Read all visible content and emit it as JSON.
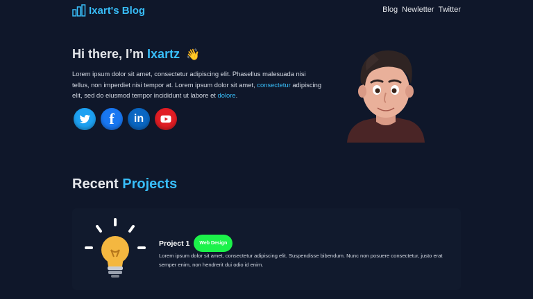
{
  "brand": {
    "name": "Ixart's Blog",
    "icon": "bar-chart-icon"
  },
  "nav": {
    "links": [
      "Blog",
      "Newletter",
      "Twitter"
    ]
  },
  "hero": {
    "greeting": "Hi there, I’m",
    "name": "Ixartz",
    "wave": "👋",
    "desc_part1": "Lorem ipsum dolor sit amet, consectetur adipiscing elit. Phasellus malesuada nisi tellus, non imperdiet nisi tempor at. Lorem ipsum dolor sit amet,",
    "link1": "consectetur",
    "desc_part2": "adipiscing elit, sed do eiusmod tempor incididunt ut labore et",
    "link2": "dolore",
    "desc_end": ".",
    "socials": [
      {
        "name": "twitter",
        "glyph": ""
      },
      {
        "name": "facebook",
        "glyph": "f"
      },
      {
        "name": "linkedin",
        "glyph": "in"
      },
      {
        "name": "youtube",
        "glyph": ""
      }
    ]
  },
  "projects": {
    "title_part1": "Recent",
    "title_part2": "Projects",
    "items": [
      {
        "name": "Project 1",
        "tag": "Web Design",
        "desc": "Lorem ipsum dolor sit amet, consectetur adipiscing elit. Suspendisse bibendum. Nunc non posuere consectetur, justo erat semper enim, non hendrerit dui odio id enim."
      }
    ]
  },
  "colors": {
    "background": "#0f172a",
    "accent": "#38bdf8",
    "card": "#111a2d",
    "badge": "#1cf24a"
  }
}
